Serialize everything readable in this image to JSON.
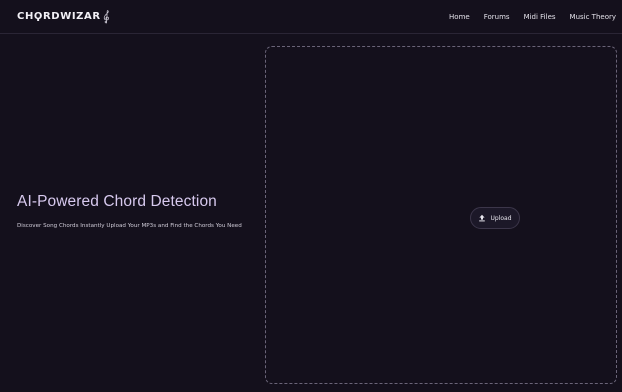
{
  "nav": {
    "logo_text": "CHϘRDWIZAR",
    "logo_icon": "treble-clef-icon",
    "links": [
      {
        "label": "Home"
      },
      {
        "label": "Forums"
      },
      {
        "label": "Midi Files"
      },
      {
        "label": "Music Theory"
      }
    ]
  },
  "hero": {
    "title": "AI-Powered Chord Detection",
    "subtitle": "Discover Song Chords Instantly Upload Your MP3s and Find the Chords You Need"
  },
  "dropzone": {
    "upload_label": "Upload",
    "upload_icon": "upload-arrow-icon"
  },
  "colors": {
    "background": "#14101c",
    "accent_title": "#d7c9ee",
    "dashed_border": "#6a6478"
  }
}
